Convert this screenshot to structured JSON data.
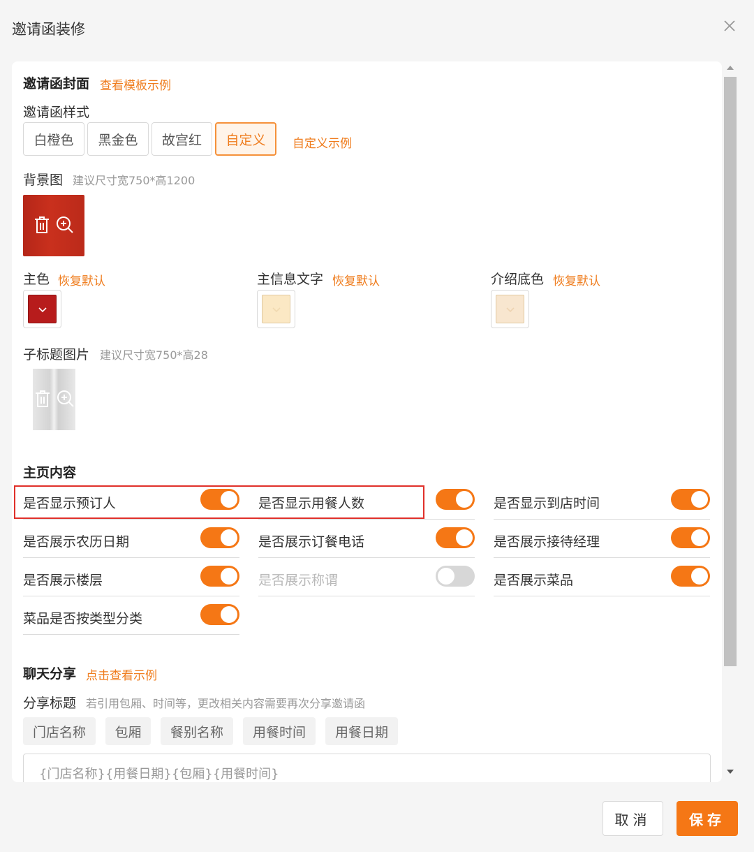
{
  "dialog": {
    "title": "邀请函装修"
  },
  "cover": {
    "title": "邀请函封面",
    "template_link": "查看模板示例",
    "style_label": "邀请函样式",
    "styles": [
      "白橙色",
      "黑金色",
      "故宫红",
      "自定义"
    ],
    "selected_style": "自定义",
    "custom_example_link": "自定义示例",
    "background_label": "背景图",
    "background_hint": "建议尺寸宽750*高1200",
    "colors": [
      {
        "label": "主色",
        "reset": "恢复默认",
        "value": "#b71c1c"
      },
      {
        "label": "主信息文字",
        "reset": "恢复默认",
        "value": "#fbe8c4"
      },
      {
        "label": "介绍底色",
        "reset": "恢复默认",
        "value": "#f8e6cf"
      }
    ],
    "subtitle_image_label": "子标题图片",
    "subtitle_image_hint": "建议尺寸宽750*高28"
  },
  "home": {
    "title": "主页内容",
    "toggles": [
      {
        "label": "是否显示预订人",
        "on": true
      },
      {
        "label": "是否显示用餐人数",
        "on": true
      },
      {
        "label": "是否显示到店时间",
        "on": true
      },
      {
        "label": "是否展示农历日期",
        "on": true
      },
      {
        "label": "是否展示订餐电话",
        "on": true
      },
      {
        "label": "是否展示接待经理",
        "on": true
      },
      {
        "label": "是否展示楼层",
        "on": true
      },
      {
        "label": "是否展示称谓",
        "on": false
      },
      {
        "label": "是否展示菜品",
        "on": true
      },
      {
        "label": "菜品是否按类型分类",
        "on": true
      }
    ]
  },
  "share": {
    "title": "聊天分享",
    "example_link": "点击查看示例",
    "share_title_label": "分享标题",
    "share_title_hint": "若引用包厢、时间等，更改相关内容需要再次分享邀请函",
    "tags": [
      "门店名称",
      "包厢",
      "餐别名称",
      "用餐时间",
      "用餐日期"
    ],
    "input_value": "{门店名称}{用餐日期}{包厢}{用餐时间}"
  },
  "footer": {
    "cancel": "取消",
    "save": "保存"
  },
  "theme": {
    "accent": "#f57715",
    "link": "#ef7c1d",
    "highlight": "#e0302a"
  }
}
